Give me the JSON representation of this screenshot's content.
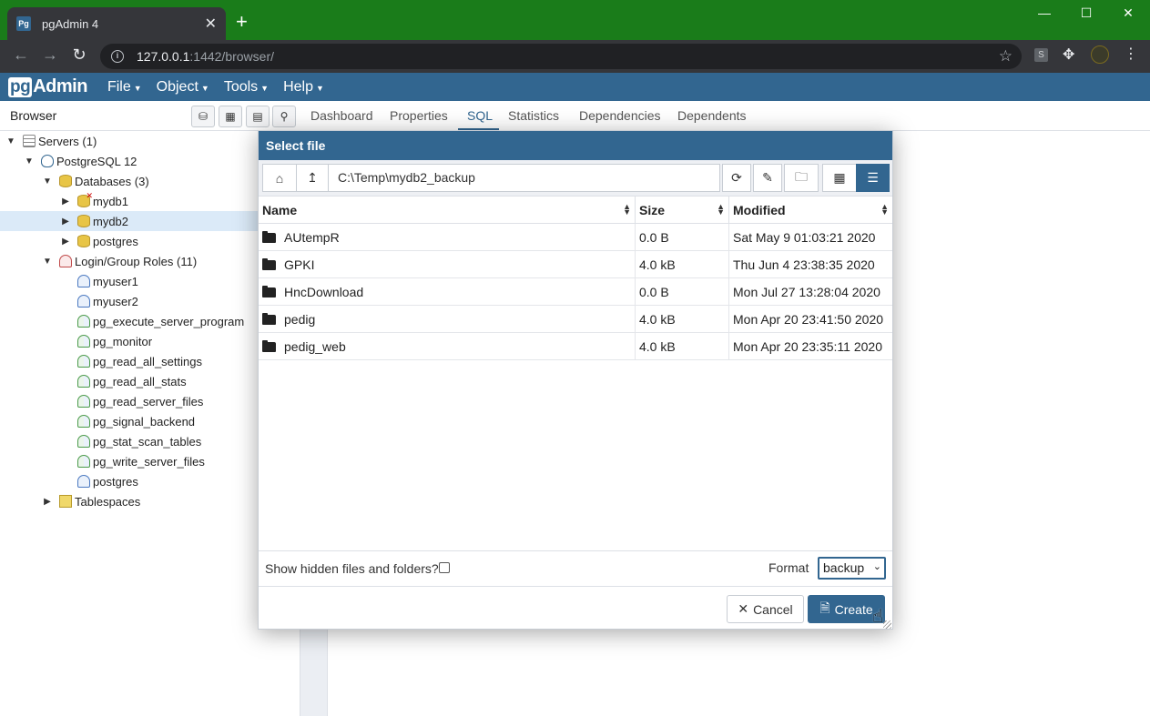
{
  "browser": {
    "tab_title": "pgAdmin 4",
    "favicon_text": "Pg",
    "url_host": "127.0.0.1",
    "url_path": ":1442/browser/",
    "ext_label": "S"
  },
  "app": {
    "logo_pg": "pg",
    "logo_rest": "Admin",
    "menu": [
      {
        "label": "File"
      },
      {
        "label": "Object"
      },
      {
        "label": "Tools"
      },
      {
        "label": "Help"
      }
    ]
  },
  "browser_panel": {
    "title": "Browser",
    "tree": [
      {
        "label": "Servers (1)"
      },
      {
        "label": "PostgreSQL 12"
      },
      {
        "label": "Databases (3)"
      },
      {
        "label": "mydb1"
      },
      {
        "label": "mydb2"
      },
      {
        "label": "postgres"
      },
      {
        "label": "Login/Group Roles (11)"
      },
      {
        "label": "myuser1"
      },
      {
        "label": "myuser2"
      },
      {
        "label": "pg_execute_server_program"
      },
      {
        "label": "pg_monitor"
      },
      {
        "label": "pg_read_all_settings"
      },
      {
        "label": "pg_read_all_stats"
      },
      {
        "label": "pg_read_server_files"
      },
      {
        "label": "pg_signal_backend"
      },
      {
        "label": "pg_stat_scan_tables"
      },
      {
        "label": "pg_write_server_files"
      },
      {
        "label": "postgres"
      },
      {
        "label": "Tablespaces"
      }
    ]
  },
  "main_tabs": [
    {
      "label": "Dashboard"
    },
    {
      "label": "Properties"
    },
    {
      "label": "SQL"
    },
    {
      "label": "Statistics"
    },
    {
      "label": "Dependencies"
    },
    {
      "label": "Dependents"
    }
  ],
  "dialog": {
    "title": "Select file",
    "path": "C:\\Temp\\mydb2_backup",
    "columns": {
      "name": "Name",
      "size": "Size",
      "modified": "Modified"
    },
    "files": [
      {
        "name": "AUtempR",
        "size": "0.0 B",
        "modified": "Sat May 9 01:03:21 2020"
      },
      {
        "name": "GPKI",
        "size": "4.0 kB",
        "modified": "Thu Jun 4 23:38:35 2020"
      },
      {
        "name": "HncDownload",
        "size": "0.0 B",
        "modified": "Mon Jul 27 13:28:04 2020"
      },
      {
        "name": "pedig",
        "size": "4.0 kB",
        "modified": "Mon Apr 20 23:41:50 2020"
      },
      {
        "name": "pedig_web",
        "size": "4.0 kB",
        "modified": "Mon Apr 20 23:35:11 2020"
      }
    ],
    "show_hidden_label": "Show hidden files and folders?",
    "show_hidden_checked": false,
    "format_label": "Format",
    "format_value": "backup",
    "cancel_label": "Cancel",
    "create_label": "Create"
  },
  "colors": {
    "chrome_frame": "#1a7c1a",
    "pgadmin_blue": "#326690",
    "selected_row": "#dbeaf8"
  }
}
